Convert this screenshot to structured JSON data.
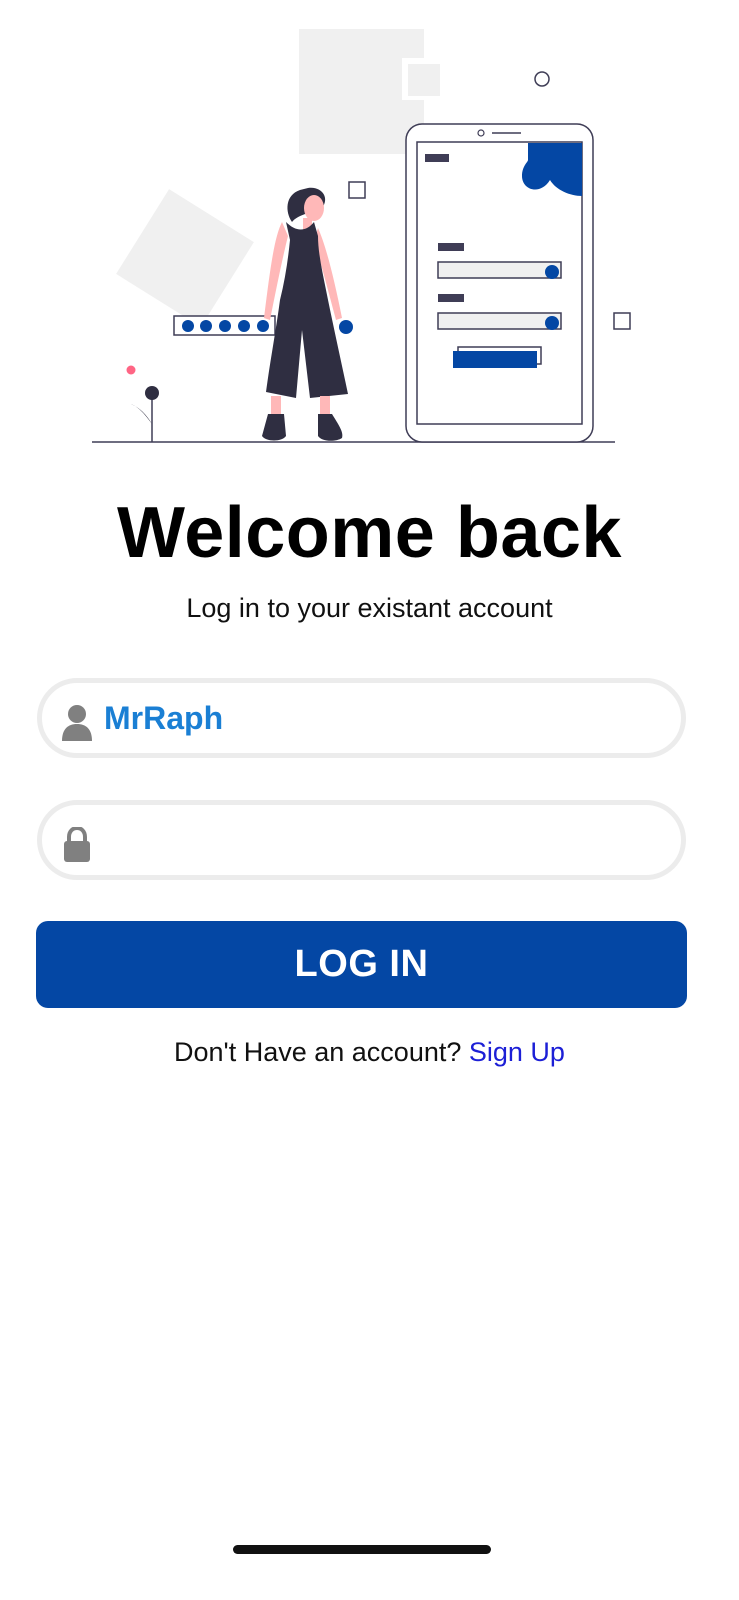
{
  "illustration": {
    "icon": "login-illustration",
    "accent_color": "#0447a4",
    "figure_color": "#2f2e41",
    "skin_color": "#ffb8b8",
    "light_shape_color": "#f0f0f0"
  },
  "welcome": {
    "title": "Welcome back",
    "subtitle": "Log in to your existant account"
  },
  "form": {
    "username": {
      "icon": "user-icon",
      "value": "MrRaph"
    },
    "password": {
      "icon": "lock-icon",
      "value": ""
    },
    "login_label": "LOG IN"
  },
  "signup": {
    "prompt": "Don't Have an account?",
    "link_label": "Sign Up"
  },
  "colors": {
    "primary": "#0447a4",
    "input_text": "#1a7fd4",
    "link": "#1c1fd6",
    "input_border": "#ececec"
  }
}
